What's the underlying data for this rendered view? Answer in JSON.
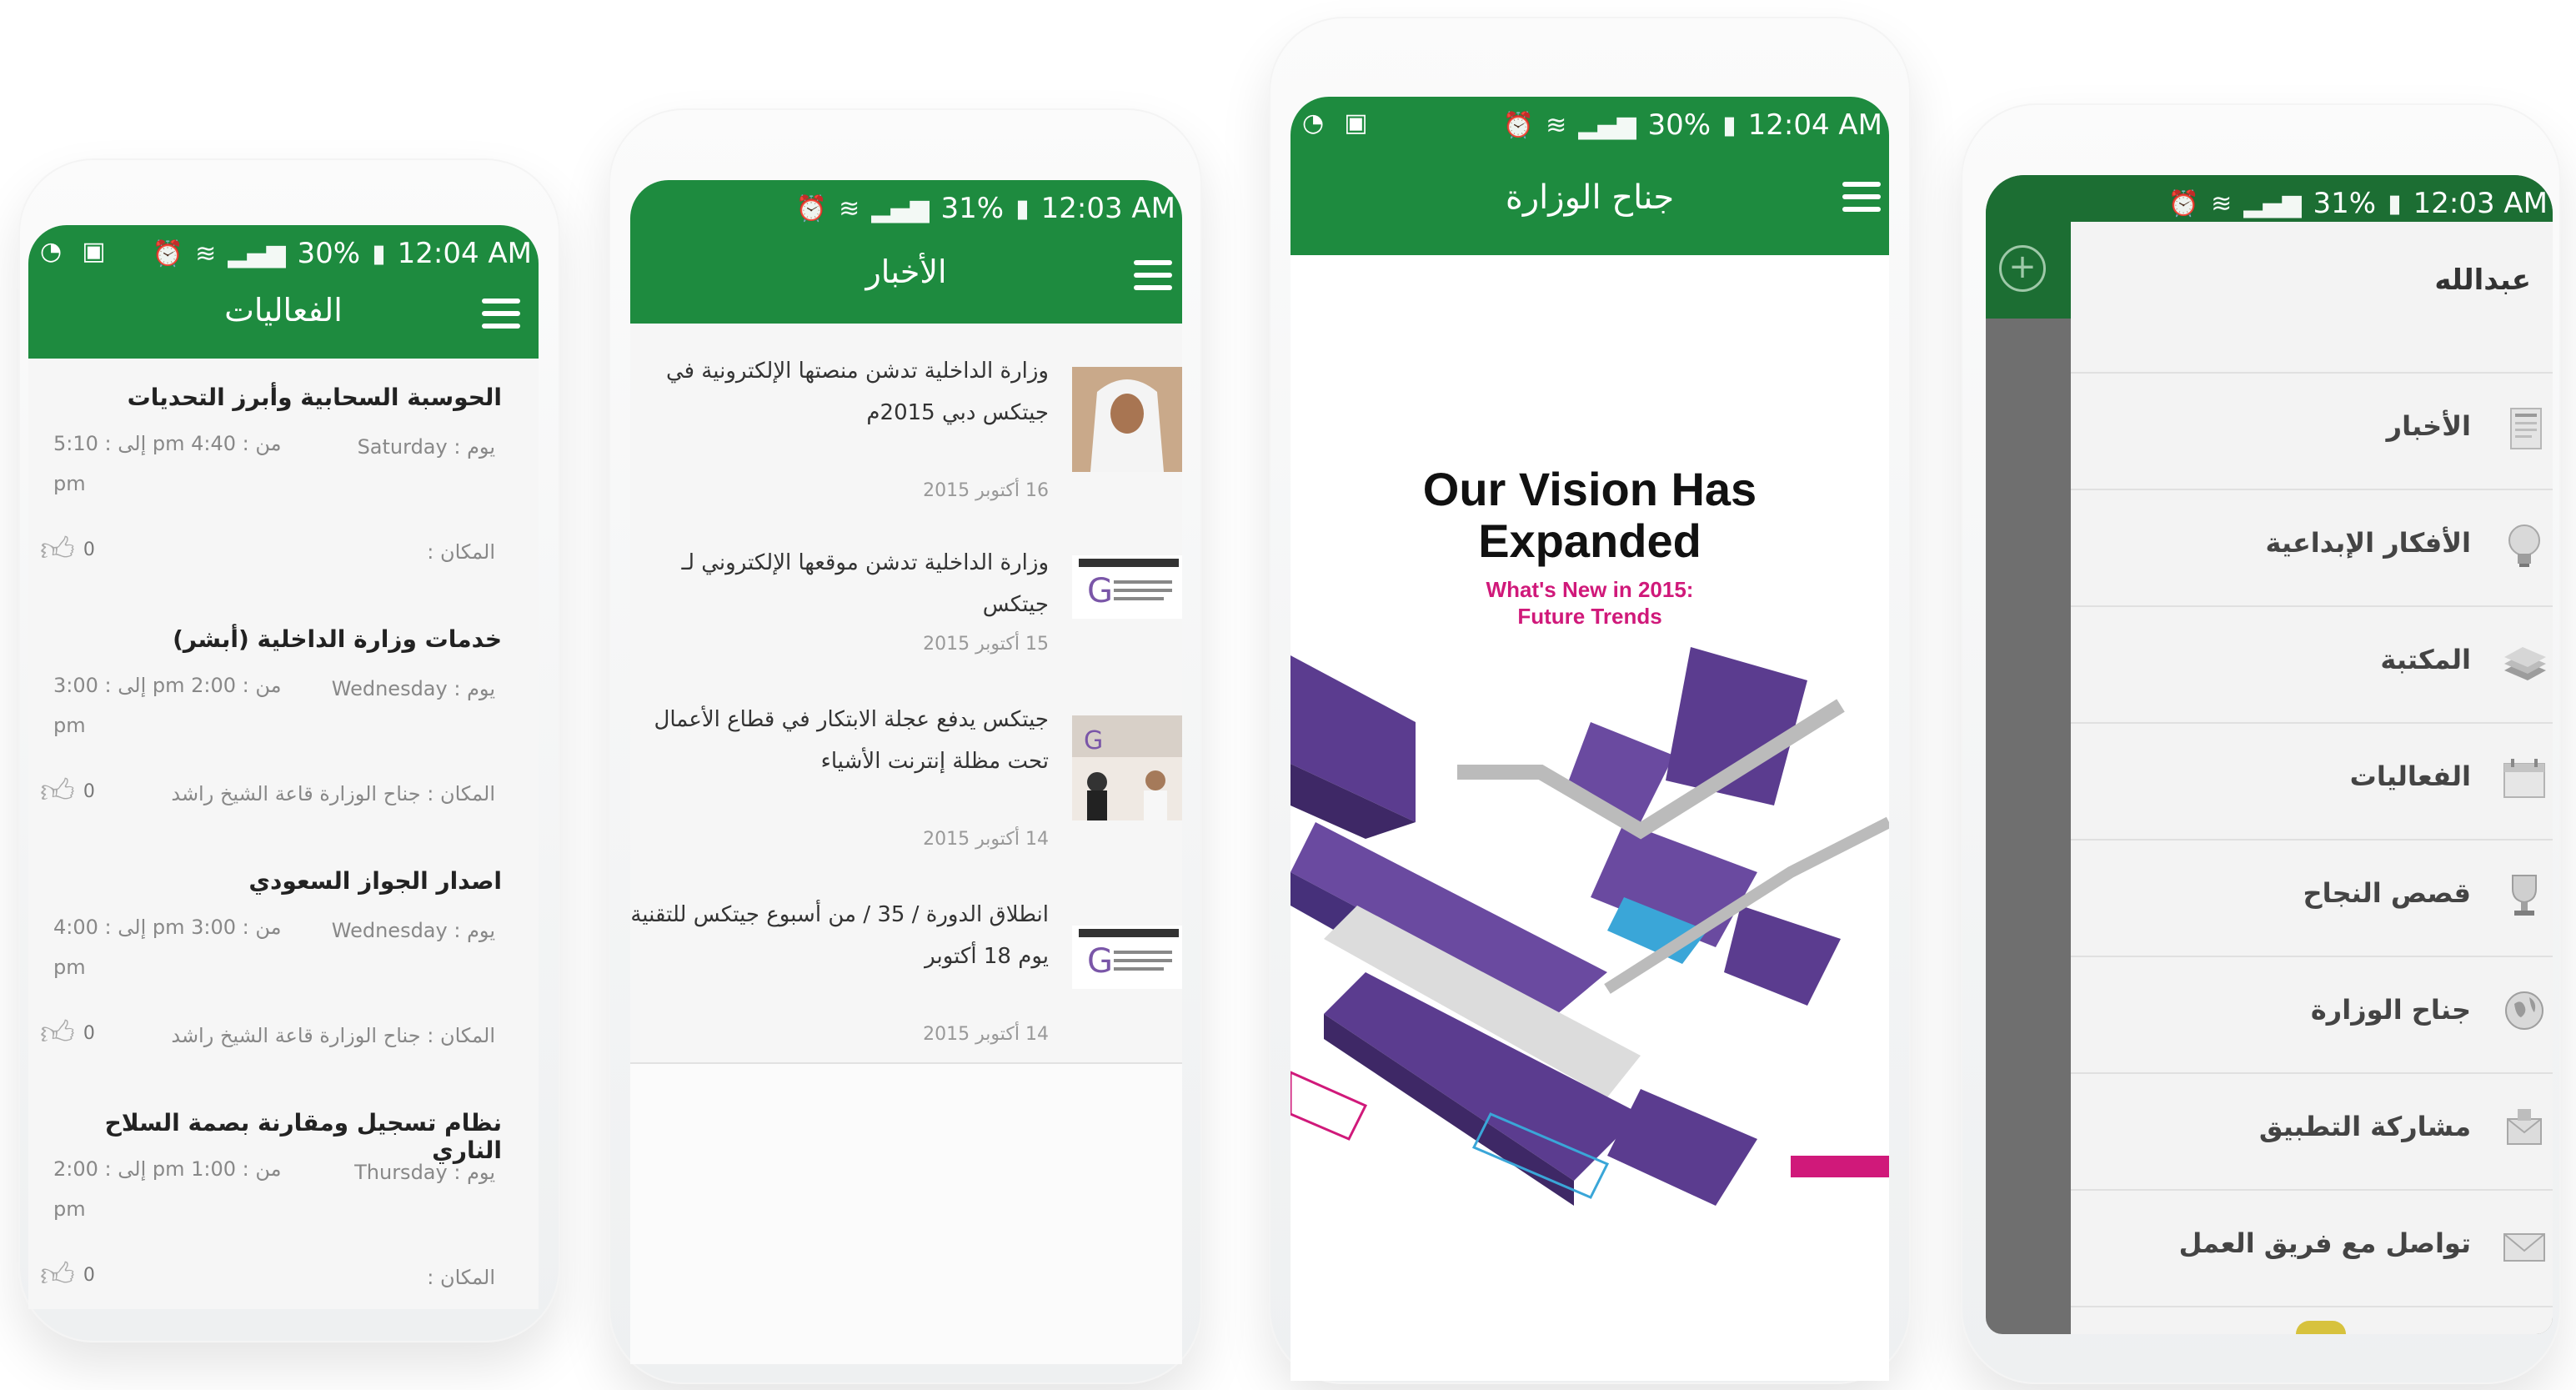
{
  "status_bars": {
    "s1": {
      "battery": "30%",
      "time": "12:04 AM"
    },
    "s2": {
      "battery": "31%",
      "time": "12:03 AM"
    },
    "s3": {
      "battery": "30%",
      "time": "12:04 AM"
    },
    "s4": {
      "battery": "31%",
      "time": "12:03 AM"
    }
  },
  "events_screen": {
    "title": "الفعاليات",
    "events": [
      {
        "title": "الحوسبة السحابية وأبرز التحديات",
        "day": "يوم : Saturday",
        "time": "من : 4:40 pm إلى : 5:10 pm",
        "place": "المكان :",
        "likes": "0"
      },
      {
        "title": "خدمات وزارة الداخلية (أبشر)",
        "day": "يوم : Wednesday",
        "time": "من : 2:00 pm إلى : 3:00 pm",
        "place": "المكان : جناح الوزارة قاعة الشيخ راشد",
        "likes": "0"
      },
      {
        "title": "اصدار الجواز السعودي",
        "day": "يوم : Wednesday",
        "time": "من : 3:00 pm إلى : 4:00 pm",
        "place": "المكان : جناح الوزارة قاعة الشيخ راشد",
        "likes": "0"
      },
      {
        "title": "نظام تسجيل ومقارنة بصمة السلاح الناري",
        "day": "يوم : Thursday",
        "time": "من : 1:00 pm إلى : 2:00 pm",
        "place": "المكان :",
        "likes": "0"
      }
    ]
  },
  "news_screen": {
    "title": "الأخبار",
    "items": [
      {
        "text": "وزارة الداخلية تدشن منصتها الإلكترونية في جيتكس دبي 2015م",
        "date": "16 أكتوبر 2015"
      },
      {
        "text": "وزارة الداخلية تدشن موقعها الإلكتروني لـ جيتكس",
        "date": "15 أكتوبر 2015"
      },
      {
        "text": "جيتكس يدفع عجلة الابتكار في قطاع الأعمال تحت مظلة إنترنت الأشياء",
        "date": "14 أكتوبر 2015"
      },
      {
        "text": "انطلاق الدورة / 35 / من أسبوع جيتكس للتقنية يوم 18 أكتوبر",
        "date": "14 أكتوبر 2015"
      }
    ]
  },
  "pavilion_screen": {
    "title": "جناح الوزارة",
    "poster": {
      "headline_1": "Our Vision Has",
      "headline_2": "Expanded",
      "sub_1": "What's New in 2015:",
      "sub_2": "Future Trends"
    }
  },
  "drawer_screen": {
    "user_name": "عبدالله",
    "items": [
      {
        "label": "الأخبار",
        "icon": "newspaper-icon"
      },
      {
        "label": "الأفكار الإبداعية",
        "icon": "lightbulb-icon"
      },
      {
        "label": "المكتبة",
        "icon": "books-icon"
      },
      {
        "label": "الفعاليات",
        "icon": "calendar-icon"
      },
      {
        "label": "قصص النجاح",
        "icon": "trophy-icon"
      },
      {
        "label": "جناح الوزارة",
        "icon": "globe-icon"
      },
      {
        "label": "مشاركة التطبيق",
        "icon": "share-icon"
      },
      {
        "label": "تواصل مع فريق العمل",
        "icon": "envelope-icon"
      }
    ]
  },
  "colors": {
    "brand_green": "#1e8b3f",
    "accent_purple": "#5b3c8f",
    "accent_pink": "#d0197a"
  }
}
